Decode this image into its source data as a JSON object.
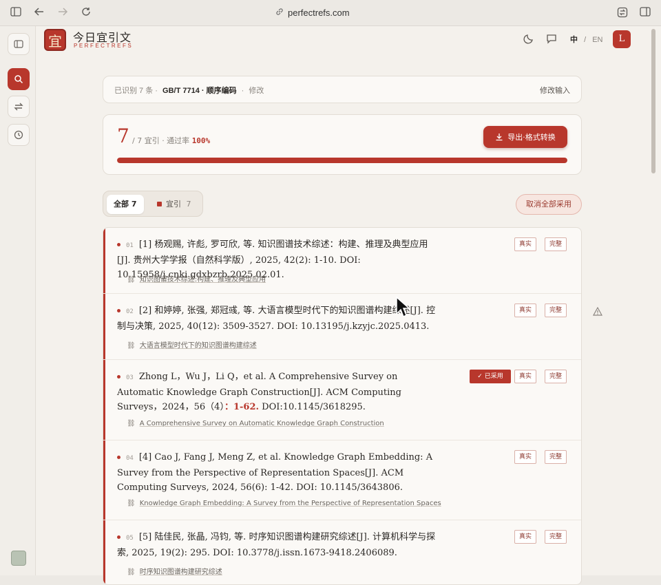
{
  "browser": {
    "url": "perfectrefs.com"
  },
  "app": {
    "name_cn": "今日宜引文",
    "name_en": "PERFECTREFS",
    "logo_char": "宜"
  },
  "header": {
    "lang_cn": "中",
    "lang_sep": "/",
    "lang_en": "EN",
    "user_initial": "L"
  },
  "info_bar": {
    "detected": "已识别 7 条 ·",
    "style": "GB/T 7714 · 顺序编码",
    "sep": "·",
    "edit": "修改",
    "edit_input": "修改输入"
  },
  "stats": {
    "count": "7",
    "summary": "/ 7 宜引 · 通过率",
    "pass_rate": "100%",
    "pass_rate_value": 1.0,
    "export_label": "导出·格式转换"
  },
  "filters": {
    "all_label": "全部",
    "all_count": "7",
    "yiyin_label": "宜引",
    "yiyin_count": "7",
    "cancel_all": "取消全部采用"
  },
  "badges": {
    "real": "真实",
    "complete": "完整",
    "adopted": "已采用"
  },
  "refs": [
    {
      "num": "01",
      "text": "[1] 杨观赐, 许彪, 罗可欣, 等. 知识图谱技术综述：构建、推理及典型应用[J]. 贵州大学学报（自然科学版）, 2025, 42(2): 1-10. DOI: 10.15958/j.cnki.gdxbzrb.2025.02.01.",
      "link": "知识图谱技术综述:构建、推理及典型应用"
    },
    {
      "num": "02",
      "text": "[2] 和婷婷, 张强, 郑冠彧, 等. 大语言模型时代下的知识图谱构建综述[J]. 控制与决策, 2025, 40(12): 3509-3527. DOI: 10.13195/j.kzyjc.2025.0413.",
      "link": "大语言模型时代下的知识图谱构建综述"
    },
    {
      "num": "03",
      "text_a": "Zhong L，Wu J，Li Q，et al. A Comprehensive Survey on Automatic Knowledge Graph Construction[J]. ACM Computing Surveys，2024，56（4）",
      "text_hl": "：1-62.",
      "text_b": " DOI:10.1145/3618295.",
      "link": "A Comprehensive Survey on Automatic Knowledge Graph Construction"
    },
    {
      "num": "04",
      "text": "[4] Cao J, Fang J, Meng Z, et al. Knowledge Graph Embedding: A Survey from the Perspective of Representation Spaces[J]. ACM Computing Surveys, 2024, 56(6): 1-42. DOI: 10.1145/3643806.",
      "link": "Knowledge Graph Embedding: A Survey from the Perspective of Representation Spaces"
    },
    {
      "num": "05",
      "text": "[5] 陆佳民, 张晶, 冯钧, 等. 时序知识图谱构建研究综述[J]. 计算机科学与探索, 2025, 19(2): 295. DOI: 10.3778/j.issn.1673-9418.2406089.",
      "link": "时序知识图谱构建研究综述"
    }
  ]
}
